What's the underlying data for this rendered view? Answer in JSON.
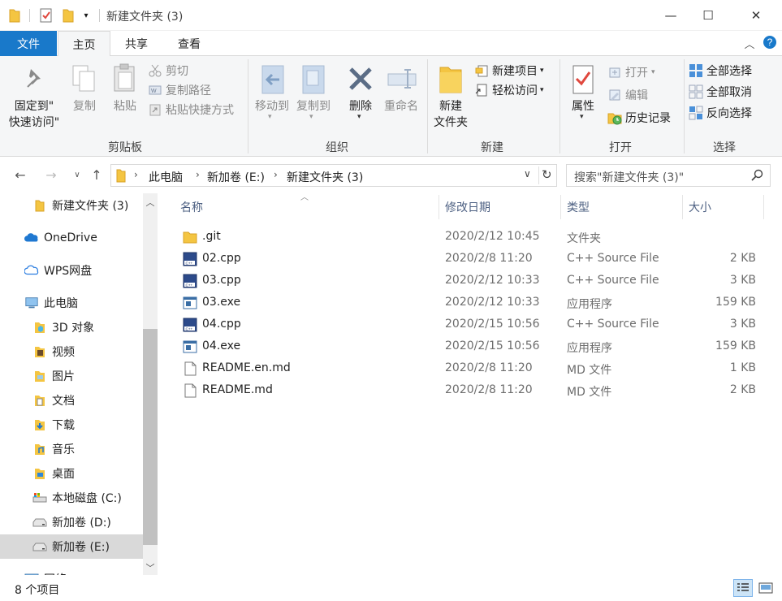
{
  "window": {
    "title": "新建文件夹 (3)",
    "minimize_glyph": "—",
    "maximize_glyph": "☐",
    "close_glyph": "✕"
  },
  "ribbon_tabs": [
    {
      "label": "文件"
    },
    {
      "label": "主页"
    },
    {
      "label": "共享"
    },
    {
      "label": "查看"
    }
  ],
  "ribbon": {
    "clipboard": {
      "pin_label_1": "固定到\"",
      "pin_label_2": "快速访问\"",
      "copy_label": "复制",
      "paste_label": "粘贴",
      "cut_label": "剪切",
      "copy_path_label": "复制路径",
      "paste_shortcut_label": "粘贴快捷方式",
      "group_label": "剪贴板"
    },
    "organize": {
      "move_label": "移动到",
      "copyto_label": "复制到",
      "delete_label": "删除",
      "rename_label": "重命名",
      "group_label": "组织"
    },
    "new": {
      "new_folder_label_1": "新建",
      "new_folder_label_2": "文件夹",
      "new_item_label": "新建项目",
      "easy_access_label": "轻松访问",
      "group_label": "新建"
    },
    "open": {
      "properties_label": "属性",
      "open_label": "打开",
      "edit_label": "编辑",
      "history_label": "历史记录",
      "group_label": "打开"
    },
    "select": {
      "select_all_label": "全部选择",
      "select_none_label": "全部取消",
      "invert_label": "反向选择",
      "group_label": "选择"
    }
  },
  "address": {
    "crumbs": [
      "此电脑",
      "新加卷 (E:)",
      "新建文件夹 (3)"
    ],
    "search_placeholder": "搜索\"新建文件夹 (3)\""
  },
  "nav_pane": {
    "items": [
      {
        "label": "新建文件夹 (3)",
        "icon": "folder-icon"
      },
      {
        "label": "OneDrive",
        "icon": "onedrive-icon"
      },
      {
        "label": "WPS网盘",
        "icon": "cloud-icon"
      },
      {
        "label": "此电脑",
        "icon": "computer-icon"
      },
      {
        "label": "3D 对象",
        "icon": "3d-objects-icon"
      },
      {
        "label": "视频",
        "icon": "videos-icon"
      },
      {
        "label": "图片",
        "icon": "pictures-icon"
      },
      {
        "label": "文档",
        "icon": "documents-icon"
      },
      {
        "label": "下载",
        "icon": "downloads-icon"
      },
      {
        "label": "音乐",
        "icon": "music-icon"
      },
      {
        "label": "桌面",
        "icon": "desktop-icon"
      },
      {
        "label": "本地磁盘 (C:)",
        "icon": "system-drive-icon"
      },
      {
        "label": "新加卷 (D:)",
        "icon": "drive-icon"
      },
      {
        "label": "新加卷 (E:)",
        "icon": "drive-icon",
        "selected": true
      },
      {
        "label": "网络",
        "icon": "network-icon"
      }
    ]
  },
  "columns": {
    "name": "名称",
    "date": "修改日期",
    "type": "类型",
    "size": "大小"
  },
  "files": [
    {
      "name": ".git",
      "date": "2020/2/12 10:45",
      "type": "文件夹",
      "size": "",
      "icon": "folder-icon"
    },
    {
      "name": "02.cpp",
      "date": "2020/2/8 11:20",
      "type": "C++ Source File",
      "size": "2 KB",
      "icon": "cpp-file-icon"
    },
    {
      "name": "03.cpp",
      "date": "2020/2/12 10:33",
      "type": "C++ Source File",
      "size": "3 KB",
      "icon": "cpp-file-icon"
    },
    {
      "name": "03.exe",
      "date": "2020/2/12 10:33",
      "type": "应用程序",
      "size": "159 KB",
      "icon": "exe-file-icon"
    },
    {
      "name": "04.cpp",
      "date": "2020/2/15 10:56",
      "type": "C++ Source File",
      "size": "3 KB",
      "icon": "cpp-file-icon"
    },
    {
      "name": "04.exe",
      "date": "2020/2/15 10:56",
      "type": "应用程序",
      "size": "159 KB",
      "icon": "exe-file-icon"
    },
    {
      "name": "README.en.md",
      "date": "2020/2/8 11:20",
      "type": "MD 文件",
      "size": "1 KB",
      "icon": "md-file-icon"
    },
    {
      "name": "README.md",
      "date": "2020/2/8 11:20",
      "type": "MD 文件",
      "size": "2 KB",
      "icon": "md-file-icon"
    }
  ],
  "status": {
    "item_count": "8 个项目"
  },
  "colors": {
    "file_tab": "#1979ca",
    "folder": "#f4c542",
    "header_text": "#4d6082"
  }
}
